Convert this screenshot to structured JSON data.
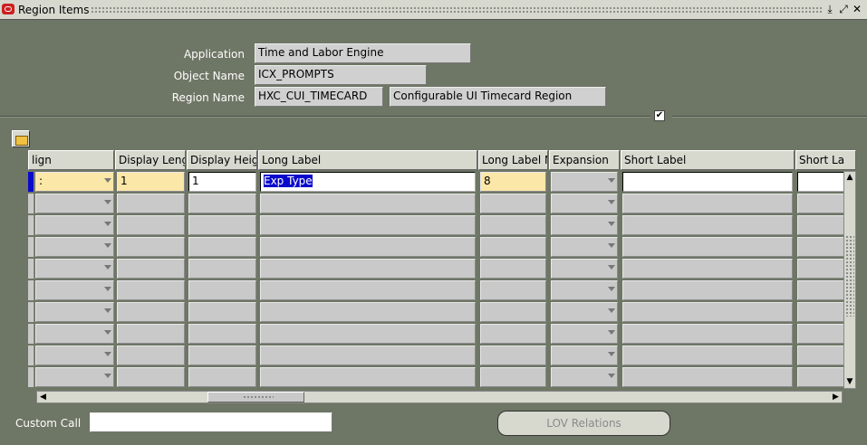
{
  "window": {
    "title": "Region Items",
    "buttons": [
      "minimize",
      "maximize",
      "close"
    ]
  },
  "header": {
    "application_label": "Application",
    "application_value": "Time and Labor Engine",
    "object_label": "Object Name",
    "object_value": "ICX_PROMPTS",
    "region_label": "Region Name",
    "region_code": "HXC_CUI_TIMECARD",
    "region_desc": "Configurable UI Timecard Region",
    "checkbox_checked": "✔"
  },
  "grid": {
    "columns": [
      "lign",
      "Display Leng",
      "Display Heig",
      "Long Label",
      "Long Label M",
      "Expansion",
      "Short Label",
      "Short La"
    ],
    "first_row": {
      "align": ":",
      "display_length": "1",
      "display_height": "1",
      "long_label": "Exp Type",
      "long_label_max": "8",
      "expansion": "",
      "short_label": "",
      "short_label2": ""
    }
  },
  "footer": {
    "custom_call_label": "Custom Call",
    "custom_call_value": "",
    "lov_button": "LOV Relations"
  },
  "colors": {
    "background": "#6e7665",
    "required": "#fbe7a8",
    "selection": "#0a0acc"
  }
}
